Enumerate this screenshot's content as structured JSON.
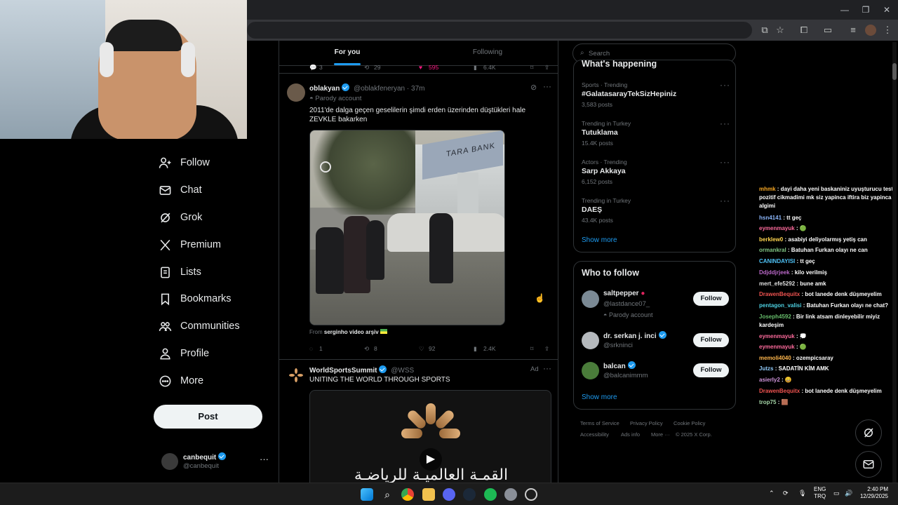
{
  "nav": {
    "items": [
      {
        "label": "Follow",
        "icon": "person-plus-icon"
      },
      {
        "label": "Chat",
        "icon": "envelope-icon"
      },
      {
        "label": "Grok",
        "icon": "grok-icon"
      },
      {
        "label": "Premium",
        "icon": "x-logo-icon"
      },
      {
        "label": "Lists",
        "icon": "list-icon"
      },
      {
        "label": "Bookmarks",
        "icon": "bookmark-icon"
      },
      {
        "label": "Communities",
        "icon": "people-icon"
      },
      {
        "label": "Profile",
        "icon": "person-icon"
      },
      {
        "label": "More",
        "icon": "more-circle-icon"
      }
    ],
    "post_label": "Post",
    "account": {
      "name": "canbequit",
      "handle": "@canbequit"
    }
  },
  "feed": {
    "tabs": [
      "For you",
      "Following"
    ],
    "prev_stats": {
      "replies": "3",
      "reposts": "29",
      "likes": "595",
      "views": "6.4K"
    },
    "post1": {
      "name": "oblakyan",
      "handle": "@oblakfeneryan",
      "time": "37m",
      "parody": "Parody account",
      "text": "2011'de dalga geçen geselilerin şimdi erden üzerinden düştükleri hale ZEVKLE bakarken",
      "media_sign": "TARA BANK",
      "from_label": "From",
      "from_source": "serginho video arşiv",
      "stats": {
        "replies": "1",
        "reposts": "8",
        "likes": "92",
        "views": "2.4K"
      }
    },
    "post2": {
      "name": "WorldSportsSummit",
      "handle": "@WSS",
      "ad_label": "Ad",
      "text": "UNITING THE WORLD THROUGH SPORTS",
      "arabic_title": "القمـة العالميـة للرياضـة"
    }
  },
  "right": {
    "search_placeholder": "Search",
    "whats_happening": "What's happening",
    "trends": [
      {
        "category": "Sports · Trending",
        "name": "#GalatasarayTekSizHepiniz",
        "posts": "3,583 posts"
      },
      {
        "category": "Trending in Turkey",
        "name": "Tutuklama",
        "posts": "15.4K posts"
      },
      {
        "category": "Actors · Trending",
        "name": "Sarp Akkaya",
        "posts": "6,152 posts"
      },
      {
        "category": "Trending in Turkey",
        "name": "DAEŞ",
        "posts": "43.4K posts"
      }
    ],
    "show_more": "Show more",
    "who_to_follow": "Who to follow",
    "suggestions": [
      {
        "name": "saltpepper",
        "handle": "@lastdance07_",
        "sub": "Parody account",
        "button": "Follow"
      },
      {
        "name": "dr. serkan j. inci",
        "handle": "@srkninci",
        "sub": "",
        "button": "Follow"
      },
      {
        "name": "balcan",
        "handle": "@balcanimmm",
        "sub": "",
        "button": "Follow"
      }
    ],
    "show_more_2": "Show more",
    "footer": [
      "Terms of Service",
      "Privacy Policy",
      "Cookie Policy",
      "Accessibility",
      "Ads info",
      "More ···",
      "© 2025 X Corp."
    ]
  },
  "chat": [
    {
      "user": "mhmk",
      "color": "#f5a623",
      "msg": ": dayi daha yeni baskaniniz uyuşturucu testi pozitif cikmadimi mk siz yapinca iftira biz yapinca algimi"
    },
    {
      "user": "hsn4141",
      "color": "#8ab4f8",
      "msg": ": tt geç"
    },
    {
      "user": "eymenmayuk",
      "color": "#ff6b9d",
      "msg": ": 🟢"
    },
    {
      "user": "berklew0",
      "color": "#ffd54f",
      "msg": ": asabiyi deliyolarmış yetiş can"
    },
    {
      "user": "ormankral",
      "color": "#81c784",
      "msg": ": Batuhan Furkan olayı ne can"
    },
    {
      "user": "CANINDAYISI",
      "color": "#4fc3f7",
      "msg": ": tt geç"
    },
    {
      "user": "Ddjddjrjeek",
      "color": "#ba68c8",
      "msg": ": kilo verilmiş"
    },
    {
      "user": "mert_efe5292",
      "color": "#e0e0e0",
      "msg": ": bune amk"
    },
    {
      "user": "DrawenBequitx",
      "color": "#ef5350",
      "msg": ": bot lanede denk düşmeyelim"
    },
    {
      "user": "pentagon_valisi",
      "color": "#4dd0e1",
      "msg": ": Batuhan Furkan olayı ne chat?"
    },
    {
      "user": "Joseph4592",
      "color": "#66bb6a",
      "msg": ": Bir link atsam dinleyebilir miyiz kardeşim"
    },
    {
      "user": "eymenmayuk",
      "color": "#ff6b9d",
      "msg": ": 💭"
    },
    {
      "user": "eymenmayuk",
      "color": "#ff6b9d",
      "msg": ": 🟢"
    },
    {
      "user": "memoli4040",
      "color": "#ffb74d",
      "msg": ": ozempicsaray"
    },
    {
      "user": "Jutzs",
      "color": "#90caf9",
      "msg": ": SADATİN KİM AMK"
    },
    {
      "user": "asierly2",
      "color": "#ce93d8",
      "msg": ": 😄"
    },
    {
      "user": "DrawenBequitx",
      "color": "#ef5350",
      "msg": ": bot lanede denk düşmeyelim"
    },
    {
      "user": "trop75",
      "color": "#a5d6a7",
      "msg": ": 🟫"
    }
  ],
  "taskbar": {
    "lang": "ENG",
    "lang2": "TRQ",
    "time": "2:40 PM",
    "date": "12/29/2025"
  }
}
